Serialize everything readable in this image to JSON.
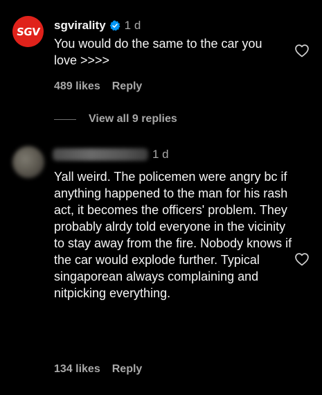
{
  "comments": [
    {
      "avatar_text": "SGV",
      "username": "sgvirality",
      "verified": true,
      "time": "1 d",
      "text": "You would do the same to the car you love >>>>",
      "likes": "489 likes",
      "reply_label": "Reply",
      "view_replies": "View all 9 replies",
      "icons": {
        "verified": "verified-badge-icon",
        "like": "heart-icon"
      }
    },
    {
      "username_obscured": true,
      "time": "1 d",
      "text": "Yall weird. The policemen were angry bc if anything happened to the man for his rash act, it becomes the officers' problem. They probably alrdy told everyone in the vicinity to stay away from the fire. Nobody knows if the car would explode further. Typical singaporean always complaining and nitpicking everything.",
      "likes": "134 likes",
      "reply_label": "Reply",
      "icons": {
        "like": "heart-icon"
      }
    }
  ],
  "colors": {
    "background": "#000000",
    "primary_text": "#f5f5f5",
    "secondary_text": "#a8a8a8",
    "verified_blue": "#0095f6",
    "brand_red": "#e0221b"
  }
}
